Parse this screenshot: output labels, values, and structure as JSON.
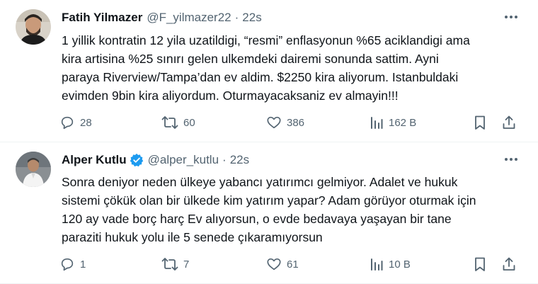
{
  "tweets": [
    {
      "name": "Fatih Yilmazer",
      "handle": "@F_yilmazer22",
      "separator": "·",
      "time": "22s",
      "text": "1 yillik kontratin 12 yila uzatildigi, “resmi” enflasyonun %65 aciklandigi ama\nkira artisina %25 sınırı gelen ulkemdeki dairemi sonunda sattim. Ayni\nparaya Riverview/Tampa’dan ev aldim. $2250 kira aliyorum. Istanbuldaki\nevimden 9bin kira aliyordum. Oturmayacaksaniz ev almayin!!!",
      "replies": "28",
      "retweets": "60",
      "likes": "386",
      "views": "162 B",
      "verified": false
    },
    {
      "name": "Alper Kutlu",
      "handle": "@alper_kutlu",
      "separator": "·",
      "time": "22s",
      "text": "Sonra deniyor neden ülkeye yabancı yatırımcı gelmiyor. Adalet ve hukuk\nsistemi çökük olan bir ülkede kim yatırım yapar? Adam görüyor oturmak için\n120 ay vade borç harç Ev alıyorsun, o evde bedavaya yaşayan bir tane\nparaziti hukuk yolu ile 5 senede çıkaramıyorsun",
      "replies": "1",
      "retweets": "7",
      "likes": "61",
      "views": "10 B",
      "verified": true
    }
  ],
  "colors": {
    "text": "#0f1419",
    "secondary": "#536471",
    "verified": "#1d9bf0",
    "divider": "#eff3f4"
  },
  "icons": {
    "more": "more-horizontal-icon",
    "reply": "reply-icon",
    "retweet": "retweet-icon",
    "like": "heart-icon",
    "views": "views-chart-icon",
    "bookmark": "bookmark-icon",
    "share": "share-icon",
    "verified": "verified-badge-icon"
  }
}
